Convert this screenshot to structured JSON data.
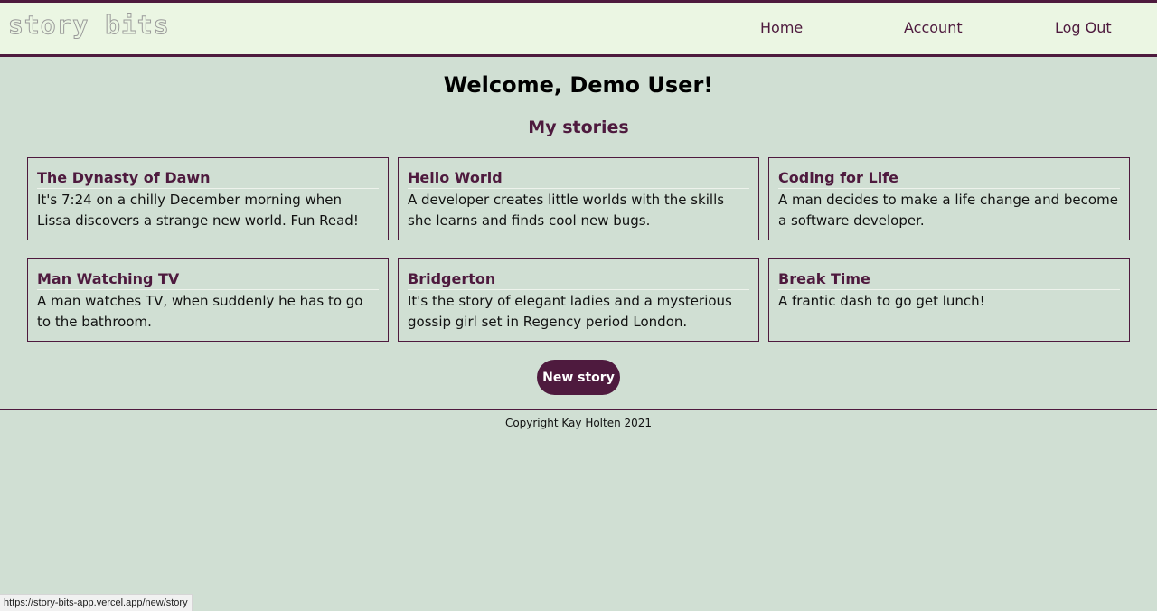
{
  "header": {
    "logo": "story bits",
    "nav": {
      "home": "Home",
      "account": "Account",
      "logout": "Log Out"
    }
  },
  "main": {
    "welcome": "Welcome, Demo User!",
    "section_title": "My stories",
    "stories": [
      {
        "title": "The Dynasty of Dawn",
        "description": "It's 7:24 on a chilly December morning when Lissa discovers a strange new world. Fun Read!"
      },
      {
        "title": "Hello World",
        "description": "A developer creates little worlds with the skills she learns and finds cool new bugs."
      },
      {
        "title": "Coding for Life",
        "description": "A man decides to make a life change and become a software developer."
      },
      {
        "title": "Man Watching TV",
        "description": "A man watches TV, when suddenly he has to go to the bathroom."
      },
      {
        "title": "Bridgerton",
        "description": "It's the story of elegant ladies and a mysterious gossip girl set in Regency period London."
      },
      {
        "title": "Break Time",
        "description": "A frantic dash to go get lunch!"
      }
    ],
    "new_story_label": "New story"
  },
  "footer": {
    "copyright": "Copyright Kay Holten 2021"
  },
  "status_bar": {
    "url": "https://story-bits-app.vercel.app/new/story"
  },
  "colors": {
    "brand": "#4e1a3e",
    "header_bg": "#ebf6e3",
    "page_bg": "#d0dfd3"
  }
}
